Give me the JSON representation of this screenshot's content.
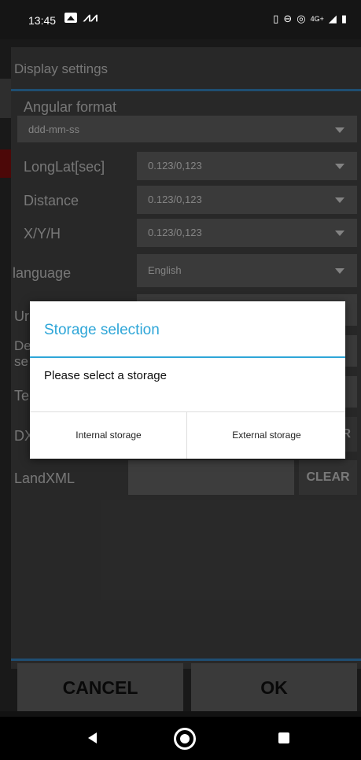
{
  "status": {
    "time": "13:45",
    "network": "4G+"
  },
  "settings": {
    "title": "Display settings",
    "angular_format_label": "Angular format",
    "angular_format_value": "ddd-mm-ss",
    "rows": [
      {
        "label": "LongLat[sec]",
        "value": "0.123/0,123"
      },
      {
        "label": "Distance",
        "value": "0.123/0,123"
      },
      {
        "label": "X/Y/H",
        "value": "0.123/0,123"
      },
      {
        "label": "language",
        "value": "English"
      }
    ],
    "partial_labels": [
      "Ur",
      "De",
      "se",
      "Te",
      "DX"
    ],
    "partial_clear": "R",
    "landxml_label": "LandXML",
    "clear_label": "CLEAR",
    "cancel_label": "CANCEL",
    "ok_label": "OK"
  },
  "dialog": {
    "title": "Storage selection",
    "message": "Please select a storage",
    "internal_label": "Internal storage",
    "external_label": "External storage"
  }
}
